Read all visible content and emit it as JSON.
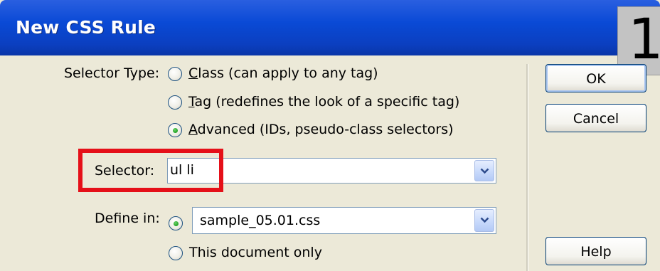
{
  "window": {
    "title": "New CSS Rule"
  },
  "step_badge": "1",
  "selector_type": {
    "label": "Selector Type:",
    "options": [
      {
        "accel": "C",
        "rest": "lass (can apply to any tag)",
        "checked": false
      },
      {
        "accel": "T",
        "rest": "ag (redefines the look of a specific tag)",
        "checked": false
      },
      {
        "accel": "A",
        "rest": "dvanced (IDs, pseudo-class selectors)",
        "checked": true
      }
    ]
  },
  "selector": {
    "label": "Selector:",
    "value": "ul li"
  },
  "define_in": {
    "label": "Define in:",
    "file_option_checked": true,
    "file_value": "sample_05.01.css",
    "document_option_label": "This document only",
    "document_option_checked": false
  },
  "buttons": {
    "ok": "OK",
    "cancel": "Cancel",
    "help": "Help"
  },
  "colors": {
    "title_bar": "#0a4ad6",
    "highlight": "#e51019",
    "dialog_bg": "#ece9d8"
  }
}
